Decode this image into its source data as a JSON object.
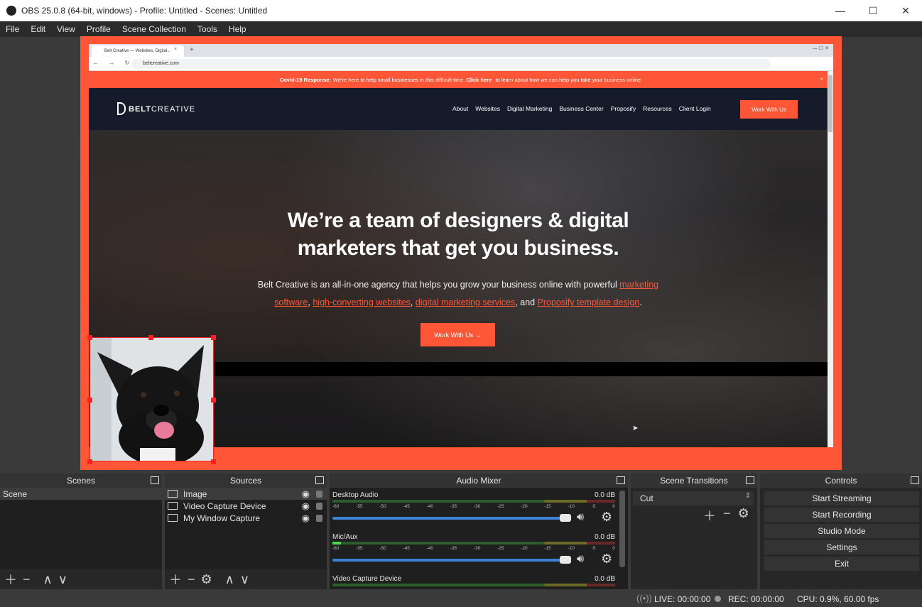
{
  "window": {
    "title": "OBS 25.0.8 (64-bit, windows) - Profile: Untitled - Scenes: Untitled",
    "minimize_glyph": "—",
    "maximize_glyph": "☐",
    "close_glyph": "✕"
  },
  "menu": [
    "File",
    "Edit",
    "View",
    "Profile",
    "Scene Collection",
    "Tools",
    "Help"
  ],
  "browser": {
    "tab_title": "Belt Creative — Websites, Digital...",
    "tab_close": "×",
    "new_tab": "+",
    "nav_glyphs": "← → ↻",
    "url": "beltcreative.com",
    "window_glyphs": "—  ☐  ✕",
    "banner_bold": "Covid-19 Response:",
    "banner_text_1": "We're here to help small businesses in this difficult time.",
    "banner_link": "Click here",
    "banner_text_2": "to learn about how we can help you take your business online.",
    "banner_close": "×"
  },
  "site": {
    "logo_bold": "BELT",
    "logo_rest": "CREATIVE",
    "nav": [
      "About",
      "Websites",
      "Digital Marketing",
      "Business Center",
      "Proposify",
      "Resources",
      "Client Login"
    ],
    "nav_cta": "Work With Us",
    "hero_title_1": "We’re a team of designers & digital",
    "hero_title_2": "marketers that get you business.",
    "hero_sub_1": "Belt Creative is an all-in-one agency that helps you grow your business online with powerful",
    "hero_link_1": "marketing software",
    "hero_comma_1": ",",
    "hero_link_2": "high-converting websites",
    "hero_comma_2": ",",
    "hero_link_3": "digital marketing services",
    "hero_and": ", and",
    "hero_link_4": "Proposify template design",
    "hero_period": ".",
    "hero_cta": "Work With Us →"
  },
  "docks": {
    "scenes": {
      "title": "Scenes",
      "items": [
        "Scene"
      ]
    },
    "sources": {
      "title": "Sources",
      "items": [
        "Image",
        "Video Capture Device",
        "My Window Capture"
      ]
    },
    "audio_mixer": {
      "title": "Audio Mixer",
      "scale": [
        "-60",
        "-55",
        "-50",
        "-45",
        "-40",
        "-35",
        "-30",
        "-25",
        "-20",
        "-15",
        "-10",
        "-5",
        "0"
      ],
      "channels": [
        {
          "name": "Desktop Audio",
          "db": "0.0 dB",
          "level": 0
        },
        {
          "name": "Mic/Aux",
          "db": "0.0 dB",
          "level": 0.03
        },
        {
          "name": "Video Capture Device",
          "db": "0.0 dB",
          "level": 0
        }
      ]
    },
    "transitions": {
      "title": "Scene Transitions",
      "selected": "Cut"
    },
    "controls": {
      "title": "Controls",
      "buttons": [
        "Start Streaming",
        "Start Recording",
        "Studio Mode",
        "Settings",
        "Exit"
      ]
    }
  },
  "status": {
    "live": "LIVE: 00:00:00",
    "rec": "REC: 00:00:00",
    "cpu": "CPU: 0.9%, 60.00 fps"
  },
  "colors": {
    "accent": "#ff5638",
    "panel": "#272727",
    "volume": "#3b82d6"
  }
}
